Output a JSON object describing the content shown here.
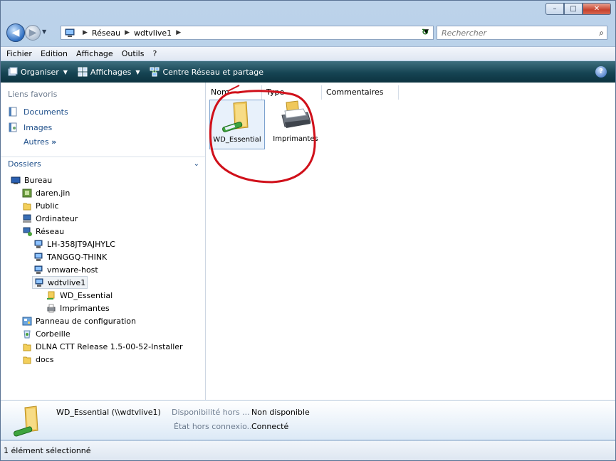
{
  "window": {
    "controls": {
      "minimize": "–",
      "maximize": "□",
      "close": "✕"
    }
  },
  "address": {
    "history_glyph": "▼",
    "crumbs": [
      "Réseau",
      "wdtvlive1"
    ],
    "crumb_sep": "▶",
    "dropdown_glyph": "▼",
    "refresh_glyph": "↻"
  },
  "search": {
    "placeholder": "Rechercher",
    "icon": "search-icon",
    "glyph": "⌕"
  },
  "menu": {
    "items": [
      "Fichier",
      "Edition",
      "Affichage",
      "Outils",
      "?"
    ]
  },
  "commandbar": {
    "organiser": "Organiser",
    "affichages": "Affichages",
    "centre": "Centre Réseau et partage",
    "caret": "▼",
    "help": "?"
  },
  "nav": {
    "favorites_title": "Liens favoris",
    "favorites": [
      "Documents",
      "Images"
    ],
    "autres": "Autres",
    "autres_glyph": "»",
    "folders_title": "Dossiers",
    "folders_chevron": "⌄",
    "tree": [
      "Bureau",
      "daren.jin",
      "Public",
      "Ordinateur",
      "Réseau",
      "LH-358JT9AJHYLC",
      "TANGGQ-THINK",
      "vmware-host",
      "wdtvlive1",
      "WD_Essential",
      "Imprimantes",
      "Panneau de configuration",
      "Corbeille",
      "DLNA CTT Release 1.5-00-52-Installer",
      "docs"
    ]
  },
  "files": {
    "columns": [
      "Nom",
      "Type",
      "Commentaires"
    ],
    "items": [
      "WD_Essential",
      "Imprimantes"
    ]
  },
  "details": {
    "name": "WD_Essential (\\\\wdtvlive1)",
    "k1": "Disponibilité hors ...",
    "v1": "Non disponible",
    "k2": "État hors connexio...",
    "v2": "Connecté"
  },
  "status": {
    "text": "1 élément sélectionné"
  },
  "colors": {
    "accent_circle": "#d0101a",
    "command_bar": "#164453",
    "link": "#1e4f8a"
  }
}
